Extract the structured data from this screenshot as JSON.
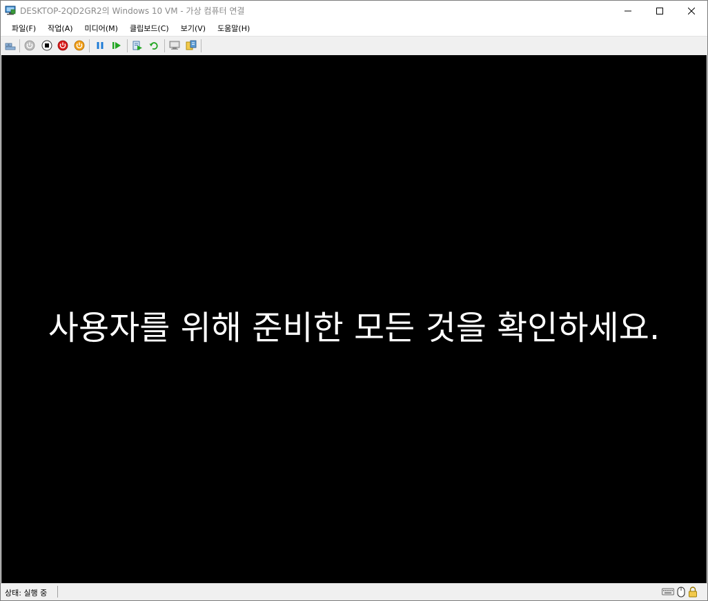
{
  "window": {
    "title": "DESKTOP-2QD2GR2의 Windows 10 VM - 가상 컴퓨터 연결",
    "icon": "vm-connect-icon"
  },
  "caption_buttons": {
    "minimize": "minimize-icon",
    "maximize": "maximize-icon",
    "close": "close-icon"
  },
  "menu": {
    "items": [
      {
        "label": "파일(F)"
      },
      {
        "label": "작업(A)"
      },
      {
        "label": "미디어(M)"
      },
      {
        "label": "클립보드(C)"
      },
      {
        "label": "보기(V)"
      },
      {
        "label": "도움말(H)"
      }
    ]
  },
  "toolbar": {
    "buttons": [
      {
        "name": "ctrl-alt-del-icon"
      },
      {
        "name": "start-icon"
      },
      {
        "name": "turn-off-icon"
      },
      {
        "name": "shut-down-icon"
      },
      {
        "name": "save-icon"
      },
      {
        "name": "pause-icon"
      },
      {
        "name": "resume-icon"
      },
      {
        "name": "checkpoint-icon"
      },
      {
        "name": "revert-icon"
      },
      {
        "name": "enhanced-session-icon"
      },
      {
        "name": "share-icon"
      }
    ]
  },
  "vm": {
    "message": "사용자를 위해 준비한 모든 것을 확인하세요."
  },
  "status": {
    "text": "상태: 실행 중",
    "icons": [
      "keyboard-icon",
      "mouse-icon",
      "lock-icon"
    ]
  },
  "colors": {
    "vm_background": "#000000",
    "vm_text": "#ffffff",
    "chrome_background": "#f0f0f0",
    "turn_off_red": "#e81123",
    "shut_down_orange": "#f7a21b",
    "pause_blue": "#1e7bd6",
    "resume_green": "#22a622"
  }
}
